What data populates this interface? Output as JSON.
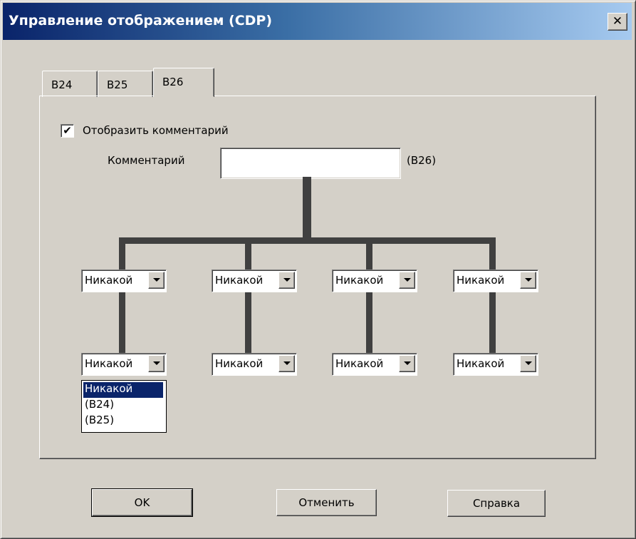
{
  "window": {
    "title": "Управление отображением (CDP)",
    "close_glyph": "✕"
  },
  "tabs": [
    {
      "label": "B24",
      "active": false
    },
    {
      "label": "B25",
      "active": false
    },
    {
      "label": "B26",
      "active": true
    }
  ],
  "panel": {
    "show_comment_checkbox": {
      "label": "Отобразить комментарий",
      "checked": true,
      "glyph": "✔"
    },
    "comment": {
      "label": "Комментарий",
      "value": "",
      "suffix": "(B26)"
    },
    "top_row_combos": [
      {
        "value": "Никакой"
      },
      {
        "value": "Никакой"
      },
      {
        "value": "Никакой"
      },
      {
        "value": "Никакой"
      }
    ],
    "bottom_row_combos": [
      {
        "value": "Никакой"
      },
      {
        "value": "Никакой"
      },
      {
        "value": "Никакой"
      },
      {
        "value": "Никакой"
      }
    ],
    "open_dropdown": {
      "options": [
        "Никакой",
        "(B24)",
        "(B25)"
      ],
      "selected_index": 0
    }
  },
  "buttons": {
    "ok": "OK",
    "cancel": "Отменить",
    "help": "Справка"
  },
  "colors": {
    "face": "#d4d0c8",
    "title_start": "#0a246a",
    "title_end": "#a6caf0",
    "selection": "#0a246a",
    "connector": "#404040"
  }
}
